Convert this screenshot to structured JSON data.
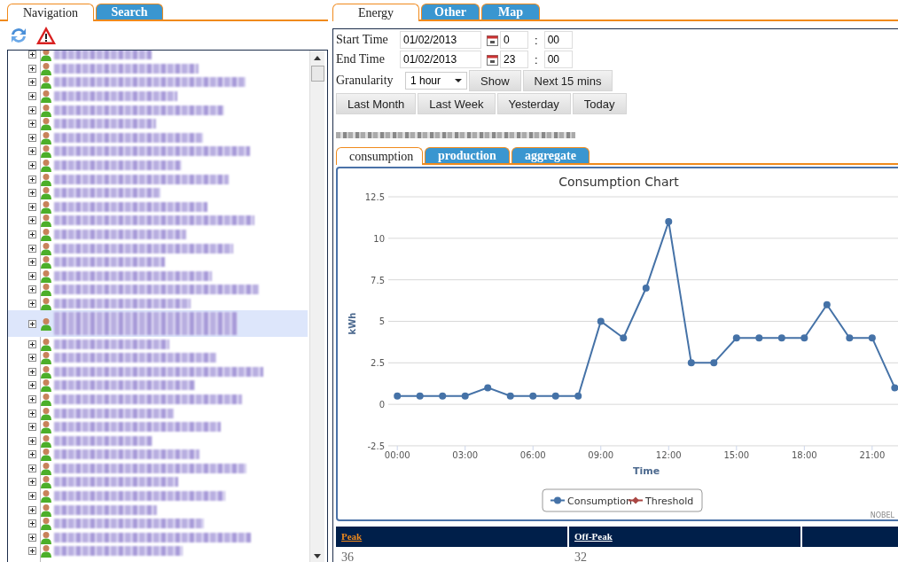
{
  "left_tabs": [
    {
      "label": "Navigation",
      "selected": true
    },
    {
      "label": "Search",
      "selected": false
    }
  ],
  "tree": {
    "items": [
      {
        "expanded": false,
        "selected": false
      },
      {
        "expanded": false,
        "selected": false
      },
      {
        "expanded": false,
        "selected": false
      },
      {
        "expanded": false,
        "selected": false
      },
      {
        "expanded": false,
        "selected": false
      },
      {
        "expanded": false,
        "selected": false
      },
      {
        "expanded": false,
        "selected": false
      },
      {
        "expanded": false,
        "selected": false
      },
      {
        "expanded": false,
        "selected": false
      },
      {
        "expanded": false,
        "selected": false
      },
      {
        "expanded": false,
        "selected": false
      },
      {
        "expanded": false,
        "selected": false
      },
      {
        "expanded": false,
        "selected": false
      },
      {
        "expanded": false,
        "selected": false
      },
      {
        "expanded": false,
        "selected": false
      },
      {
        "expanded": false,
        "selected": false
      },
      {
        "expanded": false,
        "selected": false
      },
      {
        "expanded": false,
        "selected": false
      },
      {
        "expanded": false,
        "selected": false
      },
      {
        "expanded": false,
        "selected": true
      },
      {
        "expanded": false,
        "selected": false
      },
      {
        "expanded": false,
        "selected": false
      },
      {
        "expanded": false,
        "selected": false
      },
      {
        "expanded": false,
        "selected": false
      },
      {
        "expanded": false,
        "selected": false
      },
      {
        "expanded": false,
        "selected": false
      },
      {
        "expanded": false,
        "selected": false
      },
      {
        "expanded": false,
        "selected": false
      },
      {
        "expanded": false,
        "selected": false
      },
      {
        "expanded": false,
        "selected": false
      },
      {
        "expanded": false,
        "selected": false
      },
      {
        "expanded": false,
        "selected": false
      },
      {
        "expanded": false,
        "selected": false
      },
      {
        "expanded": false,
        "selected": false
      },
      {
        "expanded": false,
        "selected": false
      },
      {
        "expanded": false,
        "selected": false
      }
    ]
  },
  "right_tabs": [
    {
      "label": "Energy",
      "selected": true
    },
    {
      "label": "Other",
      "selected": false
    },
    {
      "label": "Map",
      "selected": false
    }
  ],
  "time_rows": [
    {
      "label": "Start Time",
      "date": "01/02/2013",
      "hour": "0",
      "separator": ":",
      "minute": "00"
    },
    {
      "label": "End Time",
      "date": "01/02/2013",
      "hour": "23",
      "separator": ":",
      "minute": "00"
    }
  ],
  "granularity": {
    "label": "Granularity",
    "value": "1 hour"
  },
  "buttons": [
    "Show",
    "Next 15 mins"
  ],
  "range_buttons": [
    "Last Month",
    "Last Week",
    "Yesterday",
    "Today"
  ],
  "sub_tabs": [
    {
      "label": "consumption",
      "selected": true
    },
    {
      "label": "production",
      "selected": false
    },
    {
      "label": "aggregate",
      "selected": false
    }
  ],
  "chart": {
    "credit": "NOBEL",
    "chart_data": {
      "type": "line",
      "title": "Consumption Chart",
      "xlabel": "Time",
      "ylabel": "kWh",
      "x": [
        0,
        1,
        2,
        3,
        4,
        5,
        6,
        7,
        8,
        9,
        10,
        11,
        12,
        13,
        14,
        15,
        16,
        17,
        18,
        19,
        20,
        21,
        22
      ],
      "grid": true,
      "series": [
        {
          "name": "Consumption",
          "color": "#4572a7",
          "marker": "circle",
          "values": [
            0.5,
            0.5,
            0.5,
            0.5,
            1,
            0.5,
            0.5,
            0.5,
            0.5,
            5,
            4,
            7,
            11,
            2.5,
            2.5,
            4,
            4,
            4,
            4,
            6,
            4,
            4,
            1
          ]
        },
        {
          "name": "Threshold",
          "color": "#aa4643",
          "values": [
            null,
            null,
            null,
            null,
            null,
            null,
            null,
            null,
            null,
            null,
            null,
            null,
            null,
            null,
            null,
            null,
            null,
            null,
            null,
            null,
            null,
            null,
            null
          ]
        }
      ],
      "xlim": [
        -0.4,
        22.3
      ],
      "ylim": [
        -2.5,
        12.5
      ],
      "yticks": [
        -2.5,
        0,
        2.5,
        5,
        7.5,
        10,
        12.5
      ],
      "xticks": [
        {
          "value": 0,
          "label": "00:00"
        },
        {
          "value": 3,
          "label": "03:00"
        },
        {
          "value": 6,
          "label": "06:00"
        },
        {
          "value": 9,
          "label": "09:00"
        },
        {
          "value": 12,
          "label": "12:00"
        },
        {
          "value": 15,
          "label": "15:00"
        },
        {
          "value": 18,
          "label": "18:00"
        },
        {
          "value": 21,
          "label": "21:00"
        }
      ]
    }
  },
  "summary": {
    "columns": [
      {
        "label": "Peak",
        "selected": true
      },
      {
        "label": "Off-Peak",
        "selected": false
      }
    ],
    "values": [
      "36",
      "32"
    ]
  }
}
